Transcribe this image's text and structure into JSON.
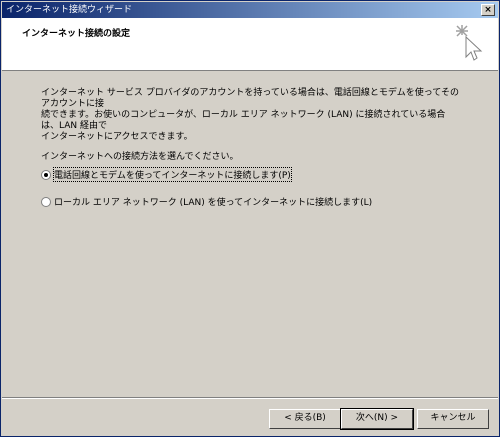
{
  "window": {
    "title": "インターネット接続ウィザード",
    "close_label": "×"
  },
  "header": {
    "title": "インターネット接続の設定",
    "icon": "wizard-sparkle-cursor-icon"
  },
  "body": {
    "description": "インターネット サービス プロバイダのアカウントを持っている場合は、電話回線とモデムを使ってそのアカウントに接\n続できます。お使いのコンピュータが、ローカル エリア ネットワーク (LAN) に接続されている場合は、LAN 経由で\nインターネットにアクセスできます。",
    "prompt": "インターネットへの接続方法を選んでください。",
    "options": [
      {
        "label": "電話回線とモデムを使ってインターネットに接続します(P)",
        "selected": true
      },
      {
        "label": "ローカル エリア ネットワーク (LAN) を使ってインターネットに接続します(L)",
        "selected": false
      }
    ]
  },
  "buttons": {
    "back": "< 戻る(B)",
    "next": "次へ(N) >",
    "cancel": "キャンセル"
  }
}
